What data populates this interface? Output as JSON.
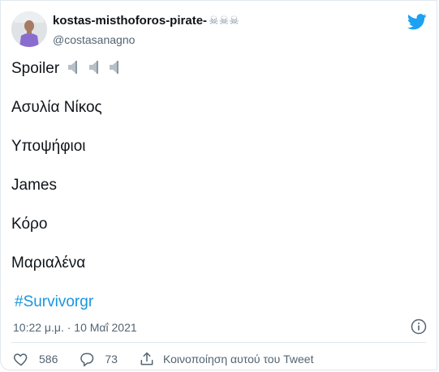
{
  "tweet": {
    "display_name": "kostas-misthoforos-pirate-",
    "name_emojis": "☠☠☠",
    "handle": "@costasanagno",
    "lines": [
      {
        "text": "Spoiler",
        "speakers": true
      },
      {
        "text": "Ασυλία Νίκος"
      },
      {
        "text": "Υποψήφιοι"
      },
      {
        "text": "James"
      },
      {
        "text": "Κόρο"
      },
      {
        "text": "Μαριαλένα"
      }
    ],
    "hashtag": "#Survivorgr",
    "timestamp": "10:22 μ.μ. · 10 Μαΐ 2021"
  },
  "actions": {
    "likes": "586",
    "replies": "73",
    "share_label": "Κοινοποίηση αυτού του Tweet"
  },
  "icons": {
    "brand": "twitter-bird-icon",
    "info": "info-icon",
    "like": "heart-icon",
    "reply": "reply-icon",
    "share": "share-icon",
    "speaker": "speaker-icon",
    "name_emoji": "skull-crossbones-icon"
  },
  "colors": {
    "brand_blue": "#1da1f2",
    "hashtag": "#1b95e0",
    "text": "#0f1419",
    "secondary": "#536471"
  }
}
